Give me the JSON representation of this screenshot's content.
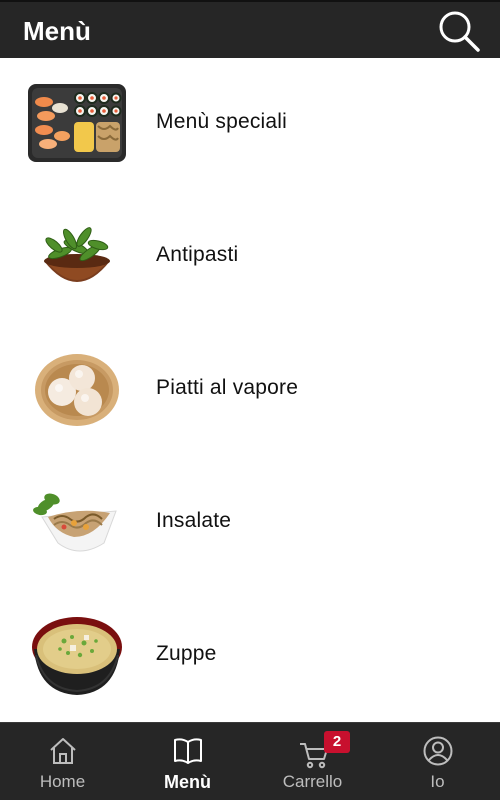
{
  "header": {
    "title": "Menù",
    "search_icon": "search-icon"
  },
  "categories": [
    {
      "label": "Menù speciali",
      "icon": "sushi-platter-image"
    },
    {
      "label": "Antipasti",
      "icon": "edamame-bowl-image"
    },
    {
      "label": "Piatti al vapore",
      "icon": "steamed-buns-basket-image"
    },
    {
      "label": "Insalate",
      "icon": "salad-bowl-image"
    },
    {
      "label": "Zuppe",
      "icon": "miso-soup-bowl-image"
    }
  ],
  "navbar": {
    "tabs": [
      {
        "label": "Home",
        "icon": "home-icon",
        "active": false
      },
      {
        "label": "Menù",
        "icon": "book-icon",
        "active": true
      },
      {
        "label": "Carrello",
        "icon": "cart-icon",
        "active": false,
        "badge": "2"
      },
      {
        "label": "Io",
        "icon": "user-icon",
        "active": false
      }
    ]
  },
  "colors": {
    "bar_background": "#262626",
    "badge": "#c8102e",
    "active_tab_text": "#ffffff",
    "inactive_tab_text": "#bdbdbd"
  }
}
